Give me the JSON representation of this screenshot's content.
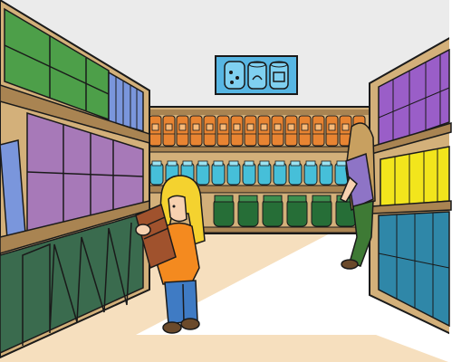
{
  "scene": {
    "description_name": "grocery-aisle-cartoon",
    "colors": {
      "outline": "#1a1a1a",
      "ceiling": "#ebebeb",
      "floor": "#f6dfbe",
      "wood": "#d3b07a",
      "wood_dark": "#a98452",
      "back_wall": "#e6e0d8",
      "sign_bg": "#57b6e3",
      "left_top_green": "#4d9f49",
      "left_mid_purple": "#a779b8",
      "left_blue_binders": "#7a96dc",
      "left_bottom_green": "#3a6b4e",
      "back_orange": "#e88432",
      "back_cyan": "#46bfd9",
      "back_jar_green": "#266e37",
      "right_purple": "#9a5ec8",
      "right_yellow": "#f2e51c",
      "right_teal": "#2f87a8",
      "girl_hair": "#f4d22f",
      "girl_shirt": "#f48a1f",
      "girl_pants": "#3f7bc4",
      "girl_skin": "#f7d1b0",
      "box_brown": "#a0522d",
      "woman_hair": "#c8a060",
      "woman_shirt": "#8e74c6",
      "woman_pants": "#3e7a35"
    },
    "elements": {
      "sign_icons": [
        "cans-icon",
        "can-icon",
        "can-icon"
      ]
    }
  }
}
